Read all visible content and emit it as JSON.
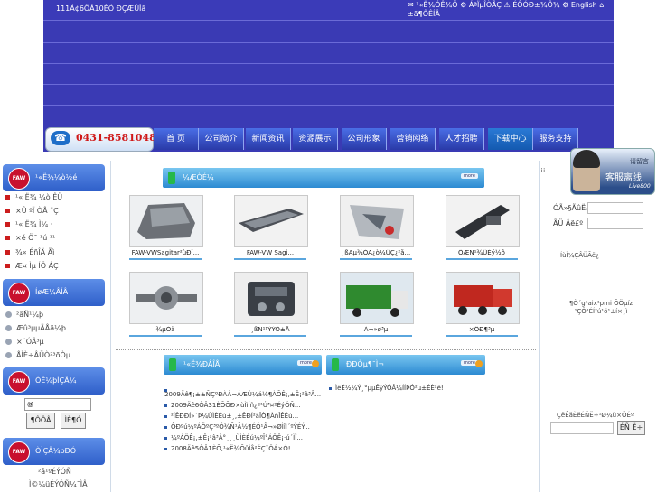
{
  "header": {
    "site_name": "111Á¢6ÕÂ10ÊÓ ÐÇÆÚÎå",
    "top_links": "✉ ¹«Ë¾ÓÊ¾Ö ⚙ ÁªÏµÎÒÃÇ ⚠ ÉÔÓÐ±¾Õ¾ ⚙ English ⌂ ±ã¶ÔÊÍÂ",
    "phone": "0431-85810489",
    "phone_icon": "phone-icon",
    "nav": [
      "首 页",
      "公司简介",
      "新闻资讯",
      "资源展示",
      "公司形象",
      "营销网络",
      "人才招聘",
      "下载中心",
      "服务支持"
    ],
    "nav_active": "下载中心",
    "colors": {
      "header_bg": "#3a3ab4",
      "nav_bg": "#2a3aa8",
      "phone_red": "#d01818"
    }
  },
  "left": {
    "sections": [
      {
        "title": "¹«Ë¾¼ò½é",
        "items": [
          "¹« Ë¾ ¼ò ÊÜ",
          "×Û ºÏ ÒÅ ¨Ç",
          "¹« Ë¾ Ì¼ ·",
          "×é Ö¯ ¹ú ¹¹",
          "¾« ÉñÎÄ Ãì",
          "Æ¤ Ìµ ÍÖ ÁÇ"
        ]
      },
      {
        "title": "ÍøÆ¼ÂÍÂ",
        "items": [
          "²âÑ¹¼þ",
          "Æû³µµÄÅä¼þ",
          "×¨ÓÃ³µ",
          "ÅÌÈ÷ÂÜÒ²³õÒµ"
        ]
      },
      {
        "title": "ÓÊ¼þÍÇÂ¼",
        "login_value": "@",
        "login_btn": "¶ÔÔÂ",
        "register_btn": "ÌÈ¶Ó"
      },
      {
        "title": "ÒÌÇÂ¼þÐÓ",
        "items": [
          "²å¹ºÉÝÓÑ",
          "Ì©¼üÉÝÓÑ¼¯ÌÂ"
        ]
      }
    ],
    "brand_badge": "FAW"
  },
  "center": {
    "products_title": "¼ÆÒÉ¼",
    "products_more": "more",
    "products": [
      "FAW-VWSagitar²ùÐÎ...",
      "FAW-VW Sagi...",
      "¸ßÃµ¾ÓÃ¿ò¼ÜÇ¿²å...",
      "ÖÆÑ¹¾ÛÉý½ô",
      "¾µÓä",
      "¸ßÑ¹¹ÝÝÖ±Å",
      "À¬»ø³µ",
      "×ÔÐ¶³µ"
    ],
    "news_left_title": "¹«Ë¾ÐÂÎÅ",
    "news_right_title": "ÐÐÒµ¶¯Ì¬",
    "news_more": "more",
    "news_left": [
      "2009Äê¶¡±±ÑÇºÐÀÀ¬ÁÆÙ¼á½¶ÀÕÊ¡,±Ê¡²â³Â...",
      "2009Äê6ÔÂ31ÈÕÕÐ×ùÌìÍñ¿ª¹Ú³¤ºÉýÓÑ...",
      "²ÍÊÐÐÍ»`Þ¼ÙÌÈÉú±¸,±ÊÐÍ²âÎÒ¶ÀñÎÊÉú...",
      "ÔÐºú¼ºÁÖºÇ³ºÖ¾Ñ¹Ã½¶ÉÓ¹Â¬»ØÌîÌ´ºÝÉÝ...",
      "¼ºÁÖÊ¡,±Ê¡²â³Â°¸¸¸ÙÌÈÉú¼ºÎ°ÁÖÊ¡·ú´ÌÎ...",
      "2008Äê5ÔÂ1ÈÕ,¹«Ë¾ÕûÌå²ÉÇ¨ÖÁ×Ó!"
    ],
    "news_right": [
      "ÌëÉ½¼Ý¸°µµÊýÝÓÂ¼ÍÍÞÓ²µ±ÉÈ²ê!"
    ]
  },
  "right": {
    "cs_label": "客服离线",
    "cs_top": "请留言",
    "cs_brand": "Live800",
    "field1_label": "ÓÃ»§ÃûË£º",
    "field2_label": "ÃÜ Âë£º",
    "register_text": "ÍùÌ¼ÇÂÜÃë¿",
    "notice_text": "¶Ò´g¹aix¹pmi ÕÖµíz ¹ÇÖ¹ÉÍ²ú¹ö¹±í×¸ì",
    "search_label": "ÇëÊäÈëÉÑË÷¹Ø¼ü×ÖÉº",
    "search_btn": "ÉÑ Ë÷"
  }
}
